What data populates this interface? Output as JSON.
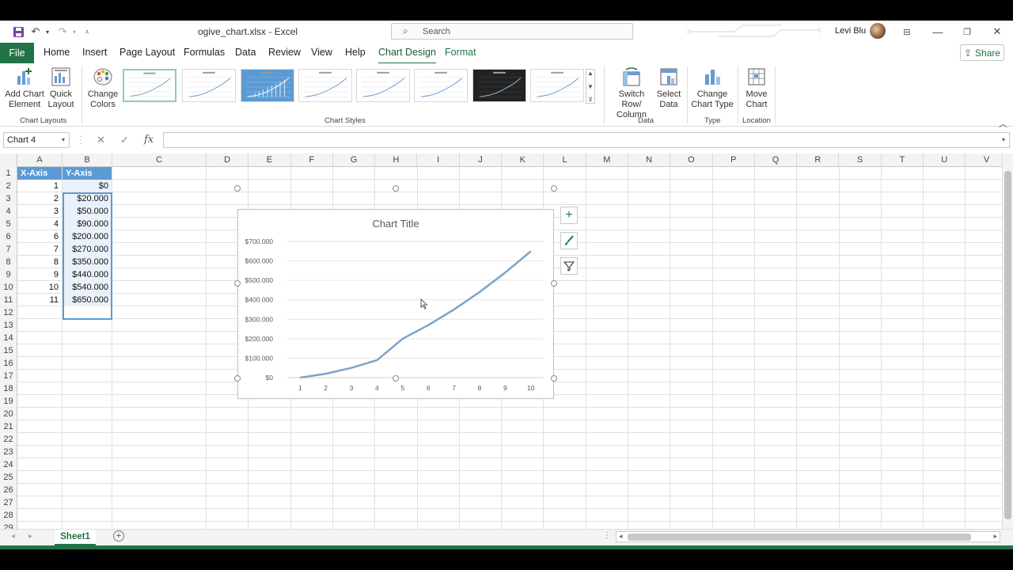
{
  "window": {
    "doc_title": "ogive_chart.xlsx  -  Excel",
    "user_name": "Levi Blu",
    "search_placeholder": "Search"
  },
  "tabs": {
    "file": "File",
    "items": [
      "Home",
      "Insert",
      "Page Layout",
      "Formulas",
      "Data",
      "Review",
      "View",
      "Help",
      "Chart Design",
      "Format"
    ],
    "active": "Chart Design",
    "share": "Share"
  },
  "ribbon": {
    "add_chart_element": [
      "Add Chart",
      "Element"
    ],
    "quick_layout": [
      "Quick",
      "Layout"
    ],
    "change_colors": [
      "Change",
      "Colors"
    ],
    "switch_row_column": [
      "Switch Row/",
      "Column"
    ],
    "select_data": [
      "Select",
      "Data"
    ],
    "change_chart_type": [
      "Change",
      "Chart Type"
    ],
    "move_chart": [
      "Move",
      "Chart"
    ],
    "groups": {
      "chart_layouts": "Chart Layouts",
      "chart_styles": "Chart Styles",
      "data": "Data",
      "type": "Type",
      "location": "Location"
    },
    "style_count": 8,
    "selected_style_index": 0
  },
  "formula_bar": {
    "name_box": "Chart 4",
    "cancel": "✕",
    "enter": "✓",
    "fx": "fx",
    "value": ""
  },
  "sheet": {
    "columns": [
      "A",
      "B",
      "C",
      "D",
      "E",
      "F",
      "G",
      "H",
      "I",
      "J",
      "K",
      "L",
      "M",
      "N",
      "O",
      "P",
      "Q",
      "R",
      "S",
      "T",
      "U",
      "V"
    ],
    "rows": [
      "1",
      "2",
      "3",
      "4",
      "5",
      "6",
      "7",
      "8",
      "9",
      "10",
      "11",
      "12",
      "13",
      "14",
      "15",
      "16",
      "17",
      "18",
      "19",
      "20",
      "21",
      "22",
      "23",
      "24",
      "25",
      "26",
      "27",
      "28",
      "29"
    ],
    "header": [
      "X-Axis",
      "Y-Axis"
    ],
    "data": [
      [
        "1",
        "$0"
      ],
      [
        "2",
        "$20.000"
      ],
      [
        "3",
        "$50.000"
      ],
      [
        "4",
        "$90.000"
      ],
      [
        "6",
        "$200.000"
      ],
      [
        "7",
        "$270.000"
      ],
      [
        "8",
        "$350.000"
      ],
      [
        "9",
        "$440.000"
      ],
      [
        "10",
        "$540.000"
      ],
      [
        "11",
        "$650.000"
      ]
    ],
    "sheet_tab": "Sheet1"
  },
  "chart_data": {
    "type": "line",
    "title": "Chart Title",
    "categories": [
      "1",
      "2",
      "3",
      "4",
      "5",
      "6",
      "7",
      "8",
      "9",
      "10"
    ],
    "series": [
      {
        "values": [
          0,
          20000,
          50000,
          90000,
          200000,
          270000,
          350000,
          440000,
          540000,
          650000
        ],
        "color": "#7ea3c7"
      }
    ],
    "ylim": [
      0,
      700000
    ],
    "yticks": [
      "$0",
      "$100.000",
      "$200.000",
      "$300.000",
      "$400.000",
      "$500.000",
      "$600.000",
      "$700.000"
    ],
    "grid": true,
    "legend": "none"
  },
  "colors": {
    "accent": "#217346",
    "table_header": "#5b9bd5",
    "series_line": "#7ea3c7"
  }
}
